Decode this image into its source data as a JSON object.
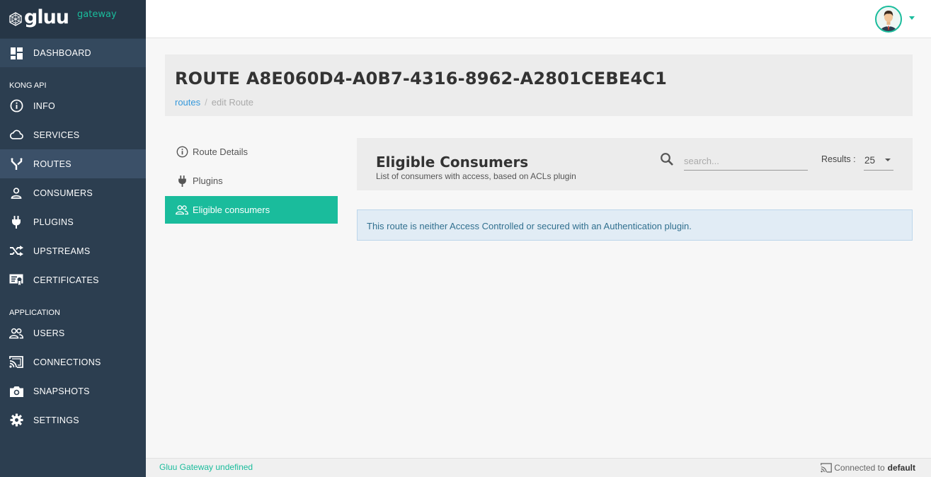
{
  "brand": {
    "name": "gluu",
    "subtitle": "gateway"
  },
  "sidebar": {
    "dashboard": "DASHBOARD",
    "section_kong": "KONG API",
    "kong_items": [
      {
        "label": "INFO",
        "icon": "info-icon"
      },
      {
        "label": "SERVICES",
        "icon": "cloud-icon"
      },
      {
        "label": "ROUTES",
        "icon": "routes-icon"
      },
      {
        "label": "CONSUMERS",
        "icon": "user-icon"
      },
      {
        "label": "PLUGINS",
        "icon": "plug-icon"
      },
      {
        "label": "UPSTREAMS",
        "icon": "shuffle-icon"
      },
      {
        "label": "CERTIFICATES",
        "icon": "certificate-icon"
      }
    ],
    "section_app": "APPLICATION",
    "app_items": [
      {
        "label": "USERS",
        "icon": "users-icon"
      },
      {
        "label": "CONNECTIONS",
        "icon": "cast-icon"
      },
      {
        "label": "SNAPSHOTS",
        "icon": "camera-icon"
      },
      {
        "label": "SETTINGS",
        "icon": "gear-icon"
      }
    ]
  },
  "page": {
    "title": "ROUTE A8E060D4-A0B7-4316-8962-A2801CEBE4C1",
    "breadcrumb": {
      "link": "routes",
      "separator": "/",
      "current": "edit Route"
    }
  },
  "subnav": {
    "route_details": "Route Details",
    "plugins": "Plugins",
    "eligible_consumers": "Eligible consumers"
  },
  "panel": {
    "title": "Eligible Consumers",
    "subtitle": "List of consumers with access, based on ACLs plugin",
    "search_placeholder": "search...",
    "results_label": "Results :",
    "results_value": "25"
  },
  "alert": "This route is neither Access Controlled or secured with an Authentication plugin.",
  "footer": {
    "left": "Gluu Gateway undefined",
    "right_prefix": "Connected to",
    "right_value": "default"
  },
  "colors": {
    "sidebar": "#2c3e50",
    "accent": "#1abc9c",
    "link": "#3498db"
  }
}
